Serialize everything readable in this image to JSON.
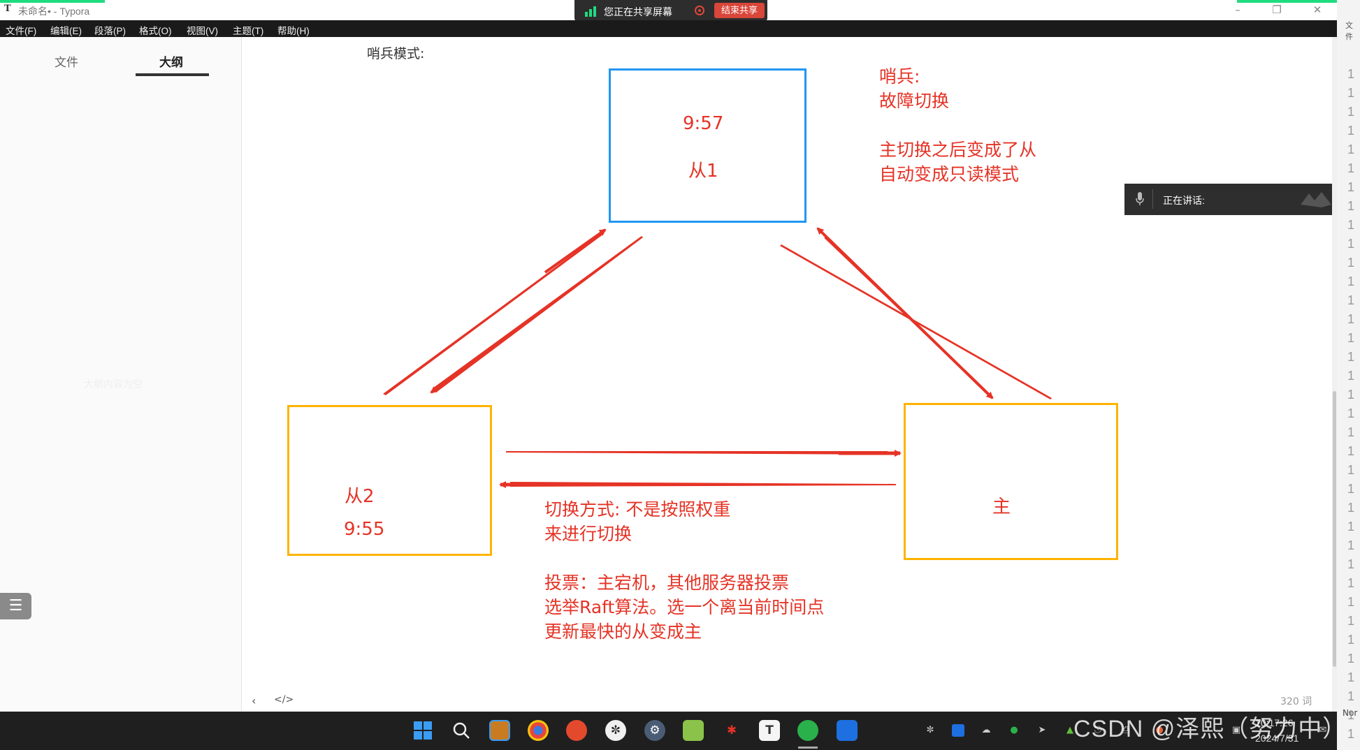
{
  "window": {
    "title": "未命名• - Typora",
    "icon_letter": "T"
  },
  "share_banner": {
    "text": "您正在共享屏幕",
    "end_button": "结束共享"
  },
  "menu": [
    "文件(F)",
    "编辑(E)",
    "段落(P)",
    "格式(O)",
    "视图(V)",
    "主题(T)",
    "帮助(H)"
  ],
  "sidebar": {
    "tabs": [
      "文件",
      "大纲"
    ],
    "active_tab": "大纲",
    "empty_text": "大纲内容为空"
  },
  "editor": {
    "heading": "哨兵模式:",
    "diagram": {
      "box_top": [
        "9:57",
        "从1"
      ],
      "box_left": [
        "从2",
        "9:55"
      ],
      "box_right": "主",
      "note_top_right": [
        "哨兵:",
        "故障切换",
        "",
        "主切换之后变成了从",
        "自动变成只读模式"
      ],
      "note_bottom": [
        "切换方式: 不是按照权重",
        "来进行切换",
        "",
        "投票：主宕机，其他服务器投票",
        "选举Raft算法。选一个离当前时间点",
        "更新最快的从变成主"
      ]
    },
    "word_count": "320 词"
  },
  "meeting": {
    "speaking_label": "正在讲话:"
  },
  "taskbar": {
    "time": "10:17:26",
    "date": "2024/7/31",
    "app_letter_typora": "T"
  },
  "watermark": "CSDN @泽熙（努力中）",
  "right_strip": {
    "label": "文件",
    "line_numbers": [
      "1",
      "1",
      "1",
      "1",
      "1",
      "1",
      "1",
      "1",
      "1",
      "1",
      "1",
      "1",
      "1",
      "1",
      "1",
      "1",
      "1",
      "1",
      "1",
      "1",
      "1",
      "1",
      "1",
      "1",
      "1",
      "1",
      "1",
      "1",
      "1",
      "1",
      "1",
      "1",
      "1",
      "1",
      "1",
      "1"
    ],
    "bottom_label": "Nor"
  },
  "colors": {
    "accent_red": "#e53326",
    "box_blue": "#2196f3",
    "box_yellow": "#ffb300",
    "green_marker": "#1fdc80"
  }
}
